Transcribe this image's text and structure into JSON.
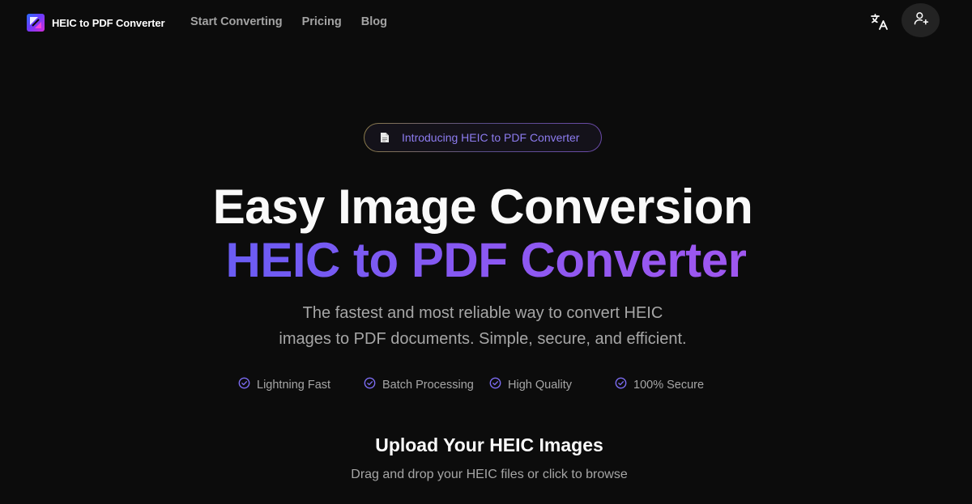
{
  "header": {
    "brand_name": "HEIC to PDF Converter",
    "logo_icon": "app-logo",
    "nav": [
      {
        "label": "Start Converting"
      },
      {
        "label": "Pricing"
      },
      {
        "label": "Blog"
      }
    ],
    "language_icon": "translate-icon",
    "user_icon": "user-plus-icon"
  },
  "hero": {
    "badge_icon": "document-icon",
    "badge_text": "Introducing HEIC to PDF Converter",
    "title_line1": "Easy Image Conversion",
    "title_line2": "HEIC to PDF Converter",
    "subtitle_line1": "The fastest and most reliable way to convert HEIC",
    "subtitle_line2": "images to PDF documents. Simple, secure, and efficient.",
    "features": [
      {
        "label": "Lightning Fast",
        "icon": "check-circle-icon"
      },
      {
        "label": "Batch Processing",
        "icon": "check-circle-icon"
      },
      {
        "label": "High Quality",
        "icon": "check-circle-icon"
      },
      {
        "label": "100% Secure",
        "icon": "check-circle-icon"
      }
    ]
  },
  "upload": {
    "title": "Upload Your HEIC Images",
    "subtitle": "Drag and drop your HEIC files or click to browse"
  },
  "colors": {
    "background": "#0c0c0c",
    "accent_start": "#6a5cf4",
    "accent_end": "#9f57ef",
    "badge_text": "#8d7cf0",
    "muted_text": "#a6a6a6"
  }
}
